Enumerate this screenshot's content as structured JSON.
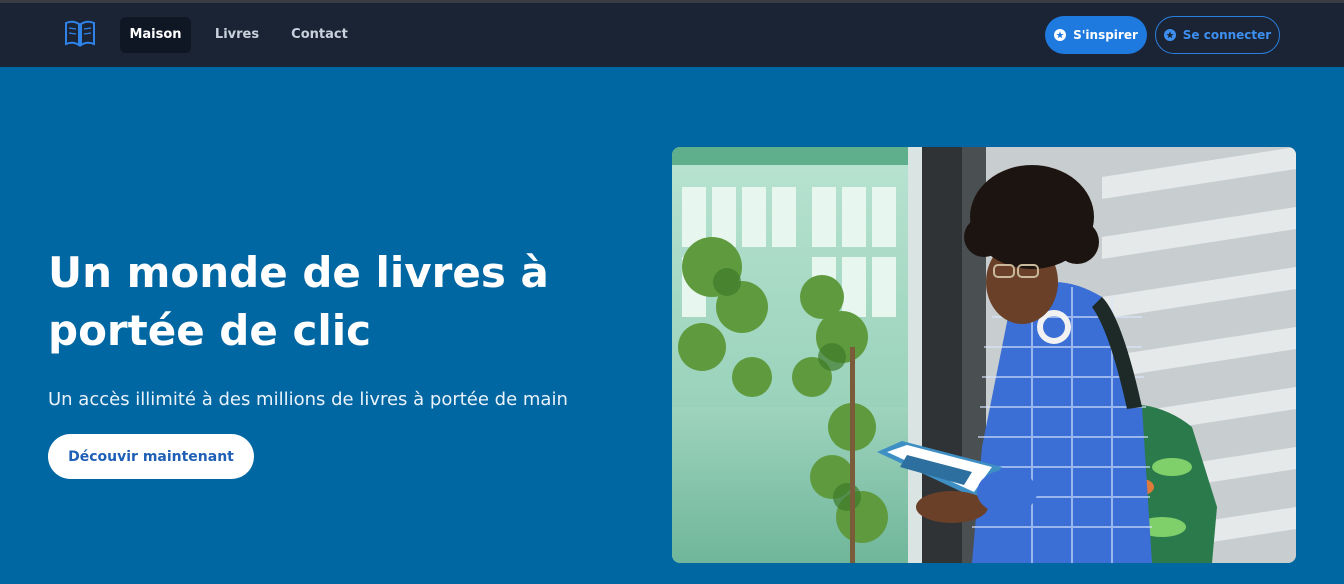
{
  "nav": {
    "logo_icon": "open-book-icon",
    "links": [
      {
        "label": "Maison",
        "active": true
      },
      {
        "label": "Livres",
        "active": false
      },
      {
        "label": "Contact",
        "active": false
      }
    ],
    "inspire_label": "S'inspirer",
    "connect_label": "Se connecter",
    "inspire_icon": "star-icon",
    "connect_icon": "star-icon"
  },
  "hero": {
    "title": "Un monde de livres à portée de clic",
    "subtitle": "Un accès illimité à des millions de livres à portée de main",
    "cta_label": "Découvir maintenant"
  },
  "colors": {
    "hero_background": "#0067a3",
    "navbar": "#1b2434",
    "primary_button": "#1f7ae0",
    "cta_text": "#1f5fb6"
  }
}
